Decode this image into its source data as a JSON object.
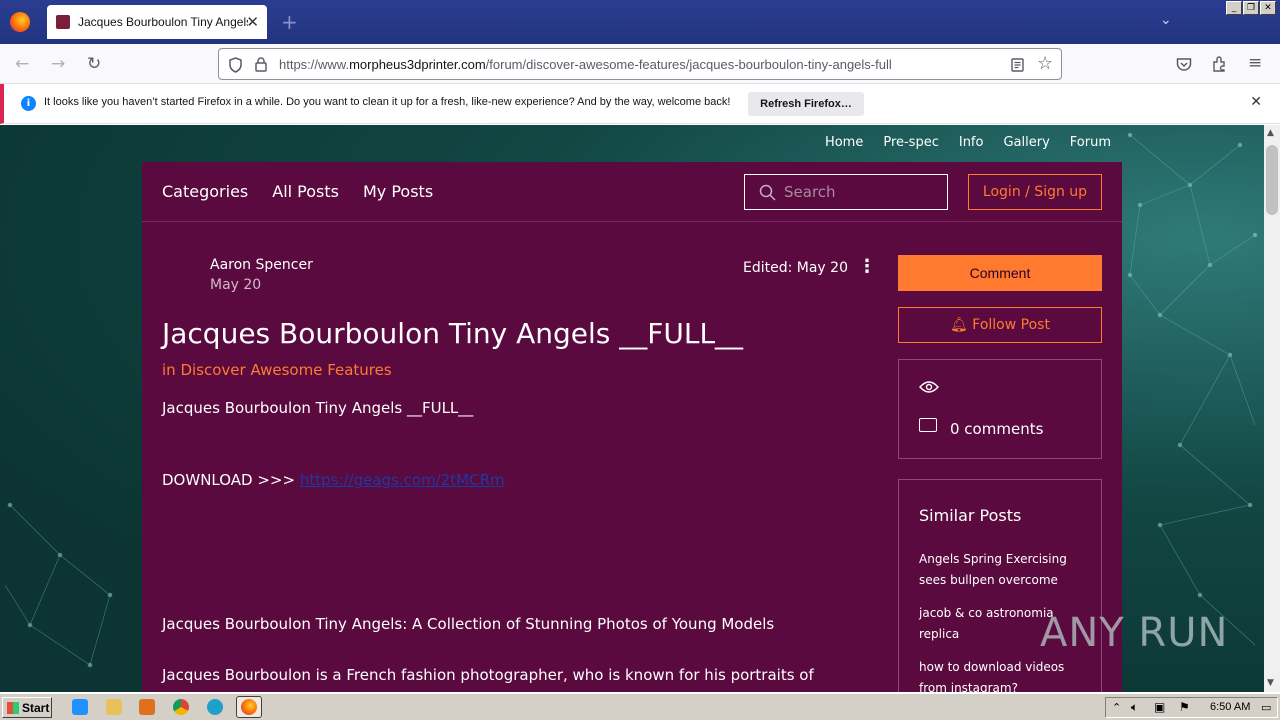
{
  "browser": {
    "tab_title": "Jacques Bourboulon Tiny Angels _",
    "url_prefix": "https://www.",
    "url_domain": "morpheus3dprinter.com",
    "url_path": "/forum/discover-awesome-features/jacques-bourboulon-tiny-angels-full",
    "new_tab": "+",
    "tab_close": "✕"
  },
  "infobar": {
    "message": "It looks like you haven’t started Firefox in a while. Do you want to clean it up for a fresh, like-new experience? And by the way, welcome back!",
    "button": "Refresh Firefox…",
    "close": "✕"
  },
  "site_nav": [
    "Home",
    "Pre-spec",
    "Info",
    "Gallery",
    "Forum"
  ],
  "forum": {
    "links": [
      "Categories",
      "All Posts",
      "My Posts"
    ],
    "search_placeholder": "Search",
    "login": "Login / Sign up"
  },
  "post": {
    "author": "Aaron Spencer",
    "date": "May 20",
    "edited": "Edited: May 20",
    "title": "Jacques Bourboulon Tiny Angels __FULL__",
    "category": "in Discover Awesome Features",
    "p1": "Jacques Bourboulon Tiny Angels __FULL__",
    "download_label": "DOWNLOAD >>> ",
    "download_link": "https://geags.com/2tMCRm",
    "p2": "Jacques Bourboulon Tiny Angels: A Collection of Stunning Photos of Young Models",
    "p3": "Jacques Bourboulon is a French fashion photographer, who is known for his portraits of young and beautiful models, often referred to as Tiny Angels, hi..."
  },
  "sidebar": {
    "comment_button": "Comment",
    "follow_button": "Follow Post",
    "comments_count": "0 comments",
    "similar_title": "Similar Posts",
    "similar_posts": [
      "Angels Spring Exercising sees bullpen overcome",
      "jacob & co astronomia replica",
      "how to download videos from instagram?"
    ]
  },
  "watermark": "ANY RUN",
  "taskbar": {
    "start": "Start",
    "clock": "6:50 AM"
  }
}
